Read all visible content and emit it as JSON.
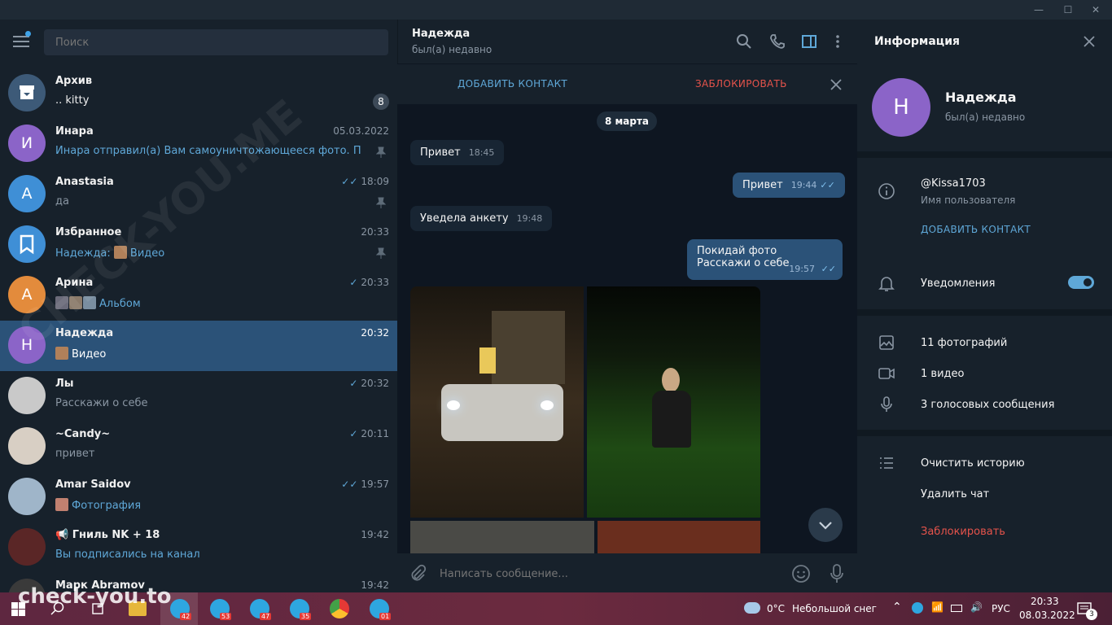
{
  "window": {
    "minimize_icon": "minimize",
    "maximize_icon": "maximize",
    "close_icon": "close"
  },
  "sidebar": {
    "search_placeholder": "Поиск",
    "chats": [
      {
        "name": "Архив",
        "preview": ".. kitty",
        "time": "",
        "badge": "8",
        "avatar_letter": "",
        "avatar_color": "#3d5a78"
      },
      {
        "name": "Инара",
        "preview": "Инара отправил(а) Вам самоуничтожающееся фото. Посмо...",
        "time": "05.03.2022",
        "avatar_letter": "И",
        "avatar_color": "#8b64c8"
      },
      {
        "name": "Anastasia",
        "preview": "да",
        "time": "18:09",
        "avatar_letter": "A",
        "avatar_color": "#3f8fd6"
      },
      {
        "name": "Избранное",
        "preview_prefix": "Надежда:",
        "preview": "Видео",
        "time": "20:33",
        "avatar_letter": "",
        "avatar_color": "#3f8fd6"
      },
      {
        "name": "Арина",
        "preview": "Альбом",
        "time": "20:33",
        "avatar_letter": "A",
        "avatar_color": "#e38b3c"
      },
      {
        "name": "Надежда",
        "preview": "Видео",
        "time": "20:32",
        "avatar_letter": "Н",
        "avatar_color": "#8b64c8"
      },
      {
        "name": "Лы",
        "preview": "Расскажи о себе",
        "time": "20:32",
        "avatar_letter": "",
        "avatar_color": "#c9c9c9"
      },
      {
        "name": "~Candy~",
        "preview": "привет",
        "time": "20:11",
        "avatar_letter": "",
        "avatar_color": "#d8cfc4"
      },
      {
        "name": "Amar Saidov",
        "preview": "Фотография",
        "time": "19:57",
        "avatar_letter": "",
        "avatar_color": "#9fb5c9"
      },
      {
        "name": "Гниль NK + 18",
        "preview": "Вы подписались на канал",
        "time": "19:42",
        "avatar_letter": "",
        "avatar_color": "#5a2626"
      },
      {
        "name": "Марк Abramov",
        "preview": "",
        "time": "19:42",
        "avatar_letter": "",
        "avatar_color": "#3a3a3a"
      }
    ]
  },
  "chat": {
    "name": "Надежда",
    "status": "был(а) недавно",
    "add_contact": "ДОБАВИТЬ КОНТАКТ",
    "block": "ЗАБЛОКИРОВАТЬ",
    "date": "8 марта",
    "messages": [
      {
        "text": "Привет",
        "time": "18:45",
        "dir": "in"
      },
      {
        "text": "Привет",
        "time": "19:44",
        "dir": "out"
      },
      {
        "text": "Уведела  анкету",
        "time": "19:48",
        "dir": "in"
      },
      {
        "text_line1": "Покидай фото",
        "text_line2": "Расскажи о себе",
        "time": "19:57",
        "dir": "out"
      }
    ],
    "composer_placeholder": "Написать сообщение..."
  },
  "info": {
    "title": "Информация",
    "avatar_letter": "Н",
    "name": "Надежда",
    "status": "был(а) недавно",
    "username": "@Kissa1703",
    "username_label": "Имя пользователя",
    "add_contact": "ДОБАВИТЬ КОНТАКТ",
    "notifications": "Уведомления",
    "notifications_on": true,
    "photos": "11 фотографий",
    "videos": "1 видео",
    "voice": "3 голосовых сообщения",
    "clear_history": "Очистить историю",
    "delete_chat": "Удалить чат",
    "block": "Заблокировать"
  },
  "taskbar": {
    "weather_temp": "0°C",
    "weather_desc": "Небольшой снег",
    "lang": "РУС",
    "time": "20:33",
    "date": "08.03.2022",
    "notifications_count": "3",
    "apps": [
      {
        "count": "42"
      },
      {
        "count": "53"
      },
      {
        "count": "47"
      },
      {
        "count": "35"
      },
      {
        "count": ""
      },
      {
        "count": "01"
      }
    ]
  },
  "watermark": {
    "text": "CHECK-YOU.ME",
    "bottom_text": "check-you.to"
  }
}
